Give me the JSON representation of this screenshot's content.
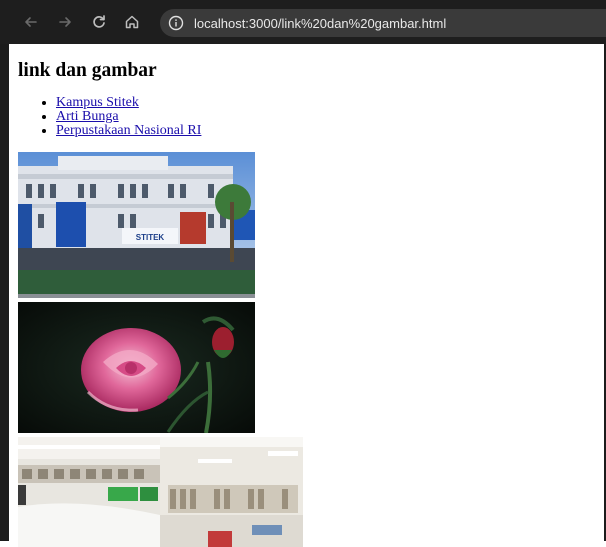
{
  "browser": {
    "url": "localhost:3000/link%20dan%20gambar.html",
    "back_icon": "arrow-left-icon",
    "forward_icon": "arrow-right-icon",
    "reload_icon": "reload-icon",
    "home_icon": "home-icon",
    "site_info_icon": "info-icon"
  },
  "page": {
    "heading": "link dan gambar",
    "links": [
      {
        "label": "Kampus Stitek"
      },
      {
        "label": "Arti Bunga"
      },
      {
        "label": "Perpustakaan Nasional RI"
      }
    ],
    "images": [
      {
        "subject": "campus building photo",
        "banner_text": "STITEK"
      },
      {
        "subject": "pink rose photo"
      },
      {
        "subject": "library interior photo"
      }
    ]
  },
  "colors": {
    "toolbar_bg": "#1e1e1e",
    "omnibox_bg": "#3a3a3a",
    "link": "#1a0dab"
  }
}
